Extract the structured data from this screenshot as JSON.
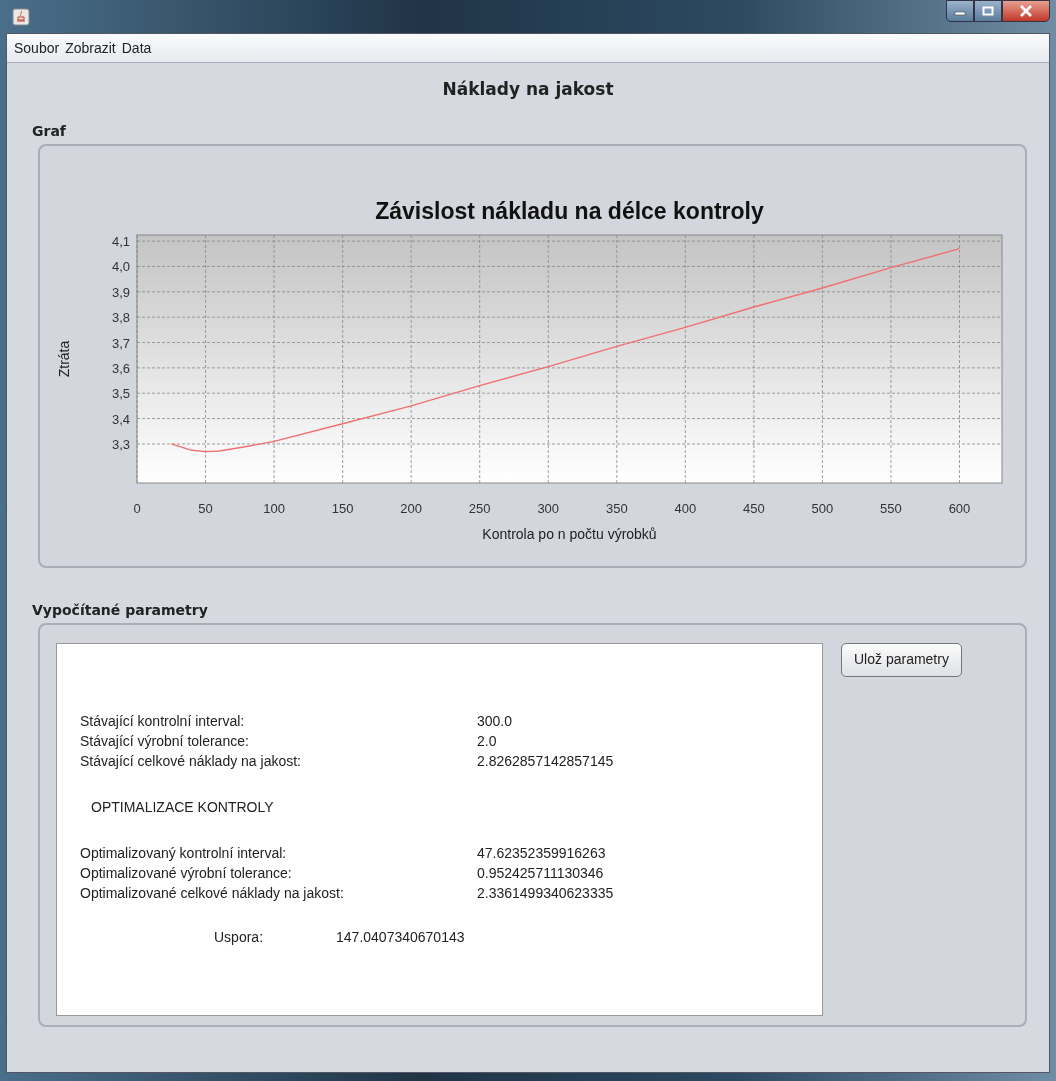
{
  "menu": [
    {
      "label": "Soubor"
    },
    {
      "label": "Zobrazit"
    },
    {
      "label": "Data"
    }
  ],
  "heading": "Náklady na jakost",
  "graph_panel": {
    "label": "Graf",
    "chart_data": {
      "type": "line",
      "title": "Závislost nákladu na délce kontroly",
      "xlabel": "Kontrola po n počtu výrobků",
      "ylabel": "Ztráta",
      "x": [
        25,
        40,
        50,
        60,
        80,
        100,
        150,
        200,
        250,
        300,
        350,
        400,
        450,
        500,
        550,
        600
      ],
      "series": [
        {
          "color": "#f07070",
          "values": [
            3.3,
            3.275,
            3.27,
            3.272,
            3.29,
            3.31,
            3.38,
            3.45,
            3.53,
            3.605,
            3.685,
            3.76,
            3.84,
            3.915,
            3.995,
            4.07
          ]
        }
      ],
      "grid": true,
      "xlim": [
        0,
        631
      ],
      "ylim": [
        3.146,
        4.124
      ],
      "xticks": [
        0,
        50,
        100,
        150,
        200,
        250,
        300,
        350,
        400,
        450,
        500,
        550,
        600
      ],
      "yticks": [
        {
          "value": 3.3,
          "label": "3,3"
        },
        {
          "value": 3.4,
          "label": "3,4"
        },
        {
          "value": 3.5,
          "label": "3,5"
        },
        {
          "value": 3.6,
          "label": "3,6"
        },
        {
          "value": 3.7,
          "label": "3,7"
        },
        {
          "value": 3.8,
          "label": "3,8"
        },
        {
          "value": 3.9,
          "label": "3,9"
        },
        {
          "value": 4.0,
          "label": "4,0"
        },
        {
          "value": 4.1,
          "label": "4,1"
        }
      ]
    }
  },
  "params_panel": {
    "label": "Vypočítané parametry",
    "rows": [
      {
        "kind": "pair",
        "label": "Stávající kontrolní interval:",
        "value": "300.0"
      },
      {
        "kind": "pair",
        "label": "Stávající výrobní tolerance:",
        "value": "2.0"
      },
      {
        "kind": "pair",
        "label": "Stávající celkové náklady na jakost:",
        "value": "2.8262857142857145"
      },
      {
        "kind": "heading",
        "label": "OPTIMALIZACE KONTROLY"
      },
      {
        "kind": "pair",
        "label": "Optimalizovaný kontrolní interval:",
        "value": "47.62352359916263"
      },
      {
        "kind": "pair",
        "label": "Optimalizované výrobní tolerance:",
        "value": "0.952425711130346"
      },
      {
        "kind": "pair",
        "label": "Optimalizované celkové náklady na jakost:",
        "value": "2.3361499340623335"
      },
      {
        "kind": "summary",
        "label": "Uspora:",
        "value": "147.0407340670143"
      }
    ],
    "button": "Ulož parametry"
  }
}
